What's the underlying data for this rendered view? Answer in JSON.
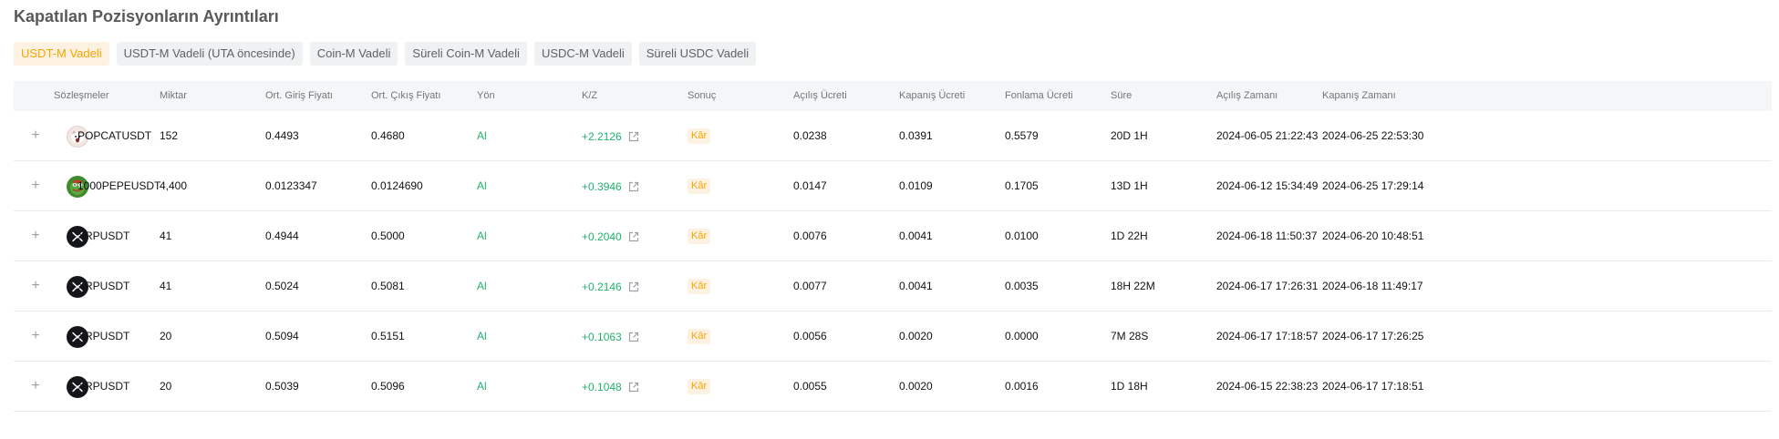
{
  "page": {
    "title": "Kapatılan Pozisyonların Ayrıntıları"
  },
  "tabs": [
    {
      "label": "USDT-M Vadeli",
      "active": true
    },
    {
      "label": "USDT-M Vadeli (UTA öncesinde)",
      "active": false
    },
    {
      "label": "Coin-M Vadeli",
      "active": false
    },
    {
      "label": "Süreli Coin-M Vadeli",
      "active": false
    },
    {
      "label": "USDC-M Vadeli",
      "active": false
    },
    {
      "label": "Süreli USDC Vadeli",
      "active": false
    }
  ],
  "table": {
    "headers": {
      "contract": "Sözleşmeler",
      "qty": "Miktar",
      "entry": "Ort. Giriş Fiyatı",
      "exit": "Ort. Çıkış Fiyatı",
      "side": "Yön",
      "pnl": "K/Z",
      "result": "Sonuç",
      "open_fee": "Açılış Ücreti",
      "close_fee": "Kapanış Ücreti",
      "funding_fee": "Fonlama Ücreti",
      "duration": "Süre",
      "open_time": "Açılış Zamanı",
      "close_time": "Kapanış Zamanı"
    },
    "rows": [
      {
        "expand": "+",
        "icon": "popcat-icon",
        "contract": "POPCATUSDT",
        "qty": "152",
        "entry": "0.4493",
        "exit": "0.4680",
        "side": "Al",
        "pnl": "+2.2126",
        "result": "Kâr",
        "open_fee": "0.0238",
        "close_fee": "0.0391",
        "funding_fee": "0.5579",
        "duration": "20D 1H",
        "open_time": "2024-06-05 21:22:43",
        "close_time": "2024-06-25 22:53:30"
      },
      {
        "expand": "+",
        "icon": "pepe-icon",
        "contract": "1000PEPEUSDT",
        "qty": "4,400",
        "entry": "0.0123347",
        "exit": "0.0124690",
        "side": "Al",
        "pnl": "+0.3946",
        "result": "Kâr",
        "open_fee": "0.0147",
        "close_fee": "0.0109",
        "funding_fee": "0.1705",
        "duration": "13D 1H",
        "open_time": "2024-06-12 15:34:49",
        "close_time": "2024-06-25 17:29:14"
      },
      {
        "expand": "+",
        "icon": "xrp-icon",
        "contract": "XRPUSDT",
        "qty": "41",
        "entry": "0.4944",
        "exit": "0.5000",
        "side": "Al",
        "pnl": "+0.2040",
        "result": "Kâr",
        "open_fee": "0.0076",
        "close_fee": "0.0041",
        "funding_fee": "0.0100",
        "duration": "1D 22H",
        "open_time": "2024-06-18 11:50:37",
        "close_time": "2024-06-20 10:48:51"
      },
      {
        "expand": "+",
        "icon": "xrp-icon",
        "contract": "XRPUSDT",
        "qty": "41",
        "entry": "0.5024",
        "exit": "0.5081",
        "side": "Al",
        "pnl": "+0.2146",
        "result": "Kâr",
        "open_fee": "0.0077",
        "close_fee": "0.0041",
        "funding_fee": "0.0035",
        "duration": "18H 22M",
        "open_time": "2024-06-17 17:26:31",
        "close_time": "2024-06-18 11:49:17"
      },
      {
        "expand": "+",
        "icon": "xrp-icon",
        "contract": "XRPUSDT",
        "qty": "20",
        "entry": "0.5094",
        "exit": "0.5151",
        "side": "Al",
        "pnl": "+0.1063",
        "result": "Kâr",
        "open_fee": "0.0056",
        "close_fee": "0.0020",
        "funding_fee": "0.0000",
        "duration": "7M 28S",
        "open_time": "2024-06-17 17:18:57",
        "close_time": "2024-06-17 17:26:25"
      },
      {
        "expand": "+",
        "icon": "xrp-icon",
        "contract": "XRPUSDT",
        "qty": "20",
        "entry": "0.5039",
        "exit": "0.5096",
        "side": "Al",
        "pnl": "+0.1048",
        "result": "Kâr",
        "open_fee": "0.0055",
        "close_fee": "0.0020",
        "funding_fee": "0.0016",
        "duration": "1D 18H",
        "open_time": "2024-06-15 22:38:23",
        "close_time": "2024-06-17 17:18:51"
      }
    ]
  },
  "colors": {
    "accent": "#f7a600",
    "profit": "#20b26c",
    "header_bg": "#f5f6f7"
  }
}
